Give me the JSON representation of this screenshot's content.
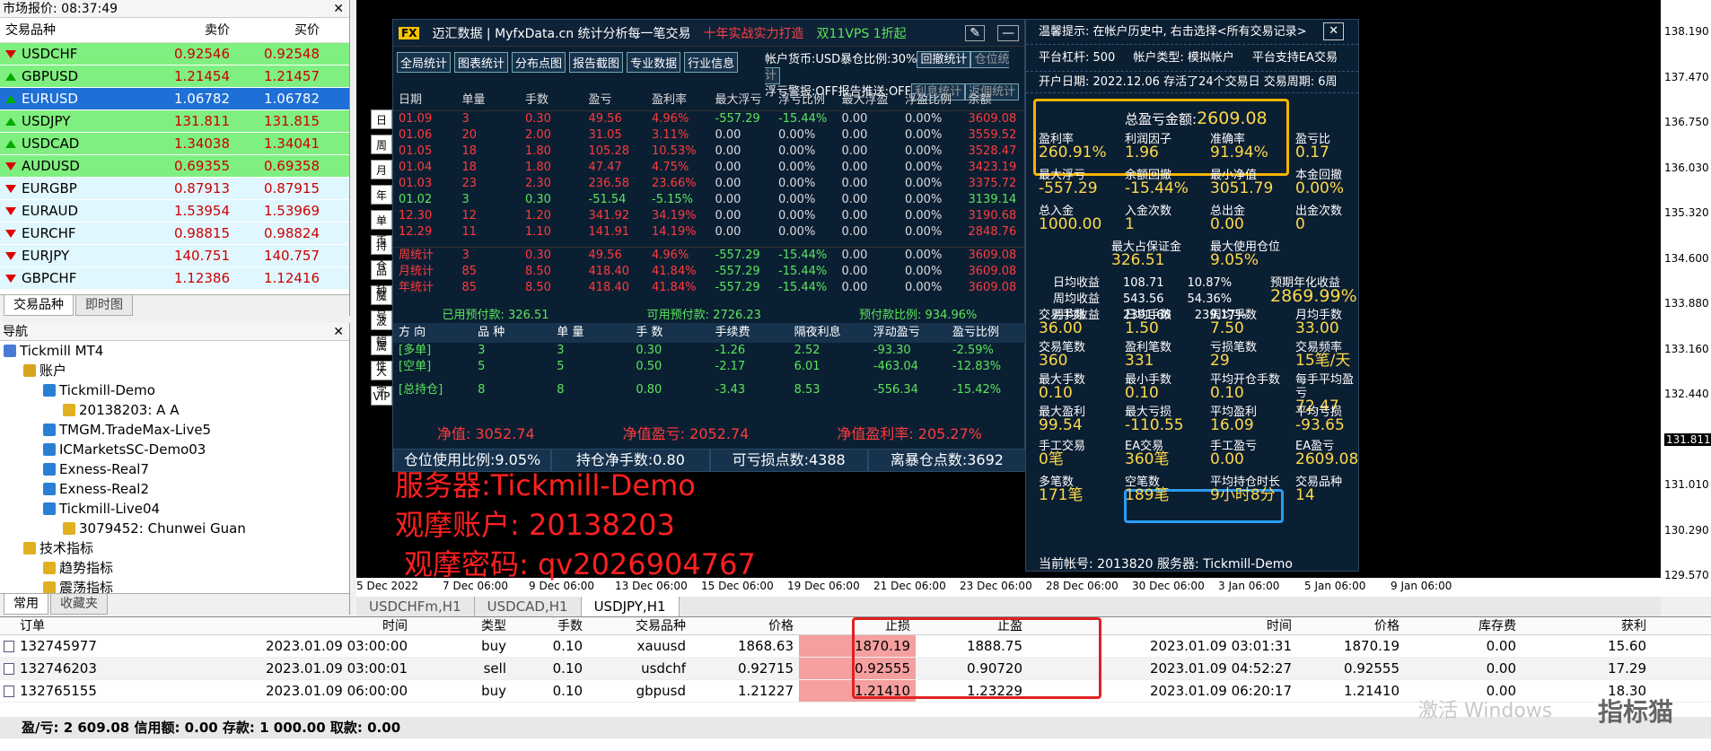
{
  "market_watch": {
    "title": "市场报价: 08:37:49",
    "col_symbol": "交易品种",
    "col_bid": "卖价",
    "col_ask": "买价",
    "rows": [
      {
        "sym": "USDCHF",
        "bid": "0.92546",
        "ask": "0.92548",
        "dir": "dn",
        "bg": "#7fef7f"
      },
      {
        "sym": "GBPUSD",
        "bid": "1.21454",
        "ask": "1.21457",
        "dir": "up",
        "bg": "#7fef7f"
      },
      {
        "sym": "EURUSD",
        "bid": "1.06782",
        "ask": "1.06782",
        "dir": "up",
        "bg": "#1e6fd6"
      },
      {
        "sym": "USDJPY",
        "bid": "131.811",
        "ask": "131.815",
        "dir": "up",
        "bg": "#7fef7f"
      },
      {
        "sym": "USDCAD",
        "bid": "1.34038",
        "ask": "1.34041",
        "dir": "up",
        "bg": "#7fef7f"
      },
      {
        "sym": "AUDUSD",
        "bid": "0.69355",
        "ask": "0.69358",
        "dir": "dn",
        "bg": "#7fef7f"
      },
      {
        "sym": "EURGBP",
        "bid": "0.87913",
        "ask": "0.87915",
        "dir": "dn",
        "bg": "#e0f7ff"
      },
      {
        "sym": "EURAUD",
        "bid": "1.53954",
        "ask": "1.53969",
        "dir": "dn",
        "bg": "#e0f7ff"
      },
      {
        "sym": "EURCHF",
        "bid": "0.98815",
        "ask": "0.98824",
        "dir": "dn",
        "bg": "#e0f7ff"
      },
      {
        "sym": "EURJPY",
        "bid": "140.751",
        "ask": "140.757",
        "dir": "dn",
        "bg": "#e0f7ff"
      },
      {
        "sym": "GBPCHF",
        "bid": "1.12386",
        "ask": "1.12416",
        "dir": "dn",
        "bg": "#e0f7ff"
      }
    ],
    "tab1": "交易品种",
    "tab2": "即时图"
  },
  "navigator": {
    "title": "导航",
    "items": [
      {
        "t": "Tickmill MT4",
        "lvl": 0,
        "c": "#4a7bd4"
      },
      {
        "t": "账户",
        "lvl": 1,
        "c": "#d8a420"
      },
      {
        "t": "Tickmill-Demo",
        "lvl": 2,
        "c": "#2a7fd4"
      },
      {
        "t": "20138203: A A",
        "lvl": 3,
        "c": "#e0b020"
      },
      {
        "t": "TMGM.TradeMax-Live5",
        "lvl": 2,
        "c": "#2a7fd4"
      },
      {
        "t": "ICMarketsSC-Demo03",
        "lvl": 2,
        "c": "#2a7fd4"
      },
      {
        "t": "Exness-Real7",
        "lvl": 2,
        "c": "#2a7fd4"
      },
      {
        "t": "Exness-Real2",
        "lvl": 2,
        "c": "#2a7fd4"
      },
      {
        "t": "Tickmill-Live04",
        "lvl": 2,
        "c": "#2a7fd4"
      },
      {
        "t": "3079452: Chunwei Guan",
        "lvl": 3,
        "c": "#e0b020"
      },
      {
        "t": "技术指标",
        "lvl": 1,
        "c": "#e0b020"
      },
      {
        "t": "趋势指标",
        "lvl": 2,
        "c": "#e0b020"
      },
      {
        "t": "震荡指标",
        "lvl": 2,
        "c": "#e0b020"
      }
    ],
    "tab1": "常用",
    "tab2": "收藏夹"
  },
  "stat": {
    "title": "迈汇数据 | MyfxData.cn  统计分析每一笔交易",
    "slogan": "十年实战实力打造",
    "promo": "双11VPS 1折起",
    "btns": [
      "全局统计",
      "图表统计",
      "分布点图",
      "报告截图",
      "专业数据",
      "行业信息"
    ],
    "info1": "帐户货币:USD暴仓比例:30%",
    "info1b": "回撤统计",
    "info1c": "仓位统计",
    "info2": "浮亏警报:OFF报告推送:OFF",
    "info2b": "利息统计",
    "info2c": "返佣统计",
    "side_btns": [
      "日",
      "周",
      "月",
      "年",
      "单币",
      "持仓",
      "品种",
      "魔号",
      "波幅",
      "属性",
      "大字",
      "VIP"
    ],
    "head": [
      "日期",
      "单量",
      "手数",
      "盈亏",
      "盈利率",
      "最大浮亏",
      "浮亏比例",
      "最大浮盈",
      "浮盈比例",
      "余额"
    ],
    "rows": [
      [
        "01.09",
        "3",
        "0.30",
        "49.56",
        "4.96%",
        "-557.29",
        "-15.44%",
        "0.00",
        "0.00%",
        "3609.08",
        "r"
      ],
      [
        "01.06",
        "20",
        "2.00",
        "31.05",
        "3.11%",
        "0.00",
        "0.00%",
        "0.00",
        "0.00%",
        "3559.52",
        "r"
      ],
      [
        "01.05",
        "18",
        "1.80",
        "105.28",
        "10.53%",
        "0.00",
        "0.00%",
        "0.00",
        "0.00%",
        "3528.47",
        "r"
      ],
      [
        "01.04",
        "18",
        "1.80",
        "47.47",
        "4.75%",
        "0.00",
        "0.00%",
        "0.00",
        "0.00%",
        "3423.19",
        "r"
      ],
      [
        "01.03",
        "23",
        "2.30",
        "236.58",
        "23.66%",
        "0.00",
        "0.00%",
        "0.00",
        "0.00%",
        "3375.72",
        "r"
      ],
      [
        "01.02",
        "3",
        "0.30",
        "-51.54",
        "-5.15%",
        "0.00",
        "0.00%",
        "0.00",
        "0.00%",
        "3139.14",
        "g"
      ],
      [
        "12.30",
        "12",
        "1.20",
        "341.92",
        "34.19%",
        "0.00",
        "0.00%",
        "0.00",
        "0.00%",
        "3190.68",
        "r"
      ],
      [
        "12.29",
        "11",
        "1.10",
        "141.91",
        "14.19%",
        "0.00",
        "0.00%",
        "0.00",
        "0.00%",
        "2848.76",
        "r"
      ]
    ],
    "sum": [
      [
        "周统计",
        "3",
        "0.30",
        "49.56",
        "4.96%",
        "-557.29",
        "-15.44%",
        "0.00",
        "0.00%",
        "3609.08"
      ],
      [
        "月统计",
        "85",
        "8.50",
        "418.40",
        "41.84%",
        "-557.29",
        "-15.44%",
        "0.00",
        "0.00%",
        "3609.08"
      ],
      [
        "年统计",
        "85",
        "8.50",
        "418.40",
        "41.84%",
        "-557.29",
        "-15.44%",
        "0.00",
        "0.00%",
        "3609.08"
      ]
    ],
    "margin_used": "已用预付款: 326.51",
    "margin_free": "可用预付款: 2726.23",
    "margin_ratio": "预付款比例: 934.96%",
    "pos_head": [
      "方 向",
      "品 种",
      "单 量",
      "手 数",
      "手续费",
      "隔夜利息",
      "浮动盈亏",
      "盈亏比例"
    ],
    "pos": [
      [
        "[多单]",
        "3",
        "3",
        "0.30",
        "-1.26",
        "2.52",
        "-93.30",
        "-2.59%"
      ],
      [
        "[空单]",
        "5",
        "5",
        "0.50",
        "-2.17",
        "6.01",
        "-463.04",
        "-12.83%"
      ],
      [
        "[总持仓]",
        "8",
        "8",
        "0.80",
        "-3.43",
        "8.53",
        "-556.34",
        "-15.42%"
      ]
    ],
    "net": "净值: 3052.74",
    "net_pl": "净值盈亏: 2052.74",
    "net_rate": "净值盈利率: 205.27%",
    "foot": [
      "仓位使用比例:9.05%",
      "持仓净手数:0.80",
      "可亏损点数:4388",
      "离暴仓点数:3692"
    ]
  },
  "overlay": {
    "l1": "服务器:Tickmill-Demo",
    "l2": "观摩账户: 20138203",
    "l3": "观摩密码: qv2026904767"
  },
  "side": {
    "tip": "温馨提示: 在帐户历史中, 右击选择<所有交易记录>",
    "lev": "平台杠杆: 500",
    "acct_type": "帐户类型: 模拟帐户",
    "ea": "平台支持EA交易",
    "open": "开户日期: 2022.12.06 存活了24个交易日 交易周期: 6周",
    "total_label": "总盈亏金额:",
    "total": "2609.08",
    "g1": [
      [
        "盈利率",
        "260.91%"
      ],
      [
        "利润因子",
        "1.96"
      ],
      [
        "准确率",
        "91.94%"
      ],
      [
        "盈亏比",
        "0.17"
      ]
    ],
    "g2": [
      [
        "最大浮亏",
        "-557.29"
      ],
      [
        "余额回撤",
        "-15.44%"
      ],
      [
        "最小净值",
        "3051.79"
      ],
      [
        "本金回撤",
        "0.00%"
      ]
    ],
    "g3": [
      [
        "总入金",
        "1000.00"
      ],
      [
        "入金次数",
        "1"
      ],
      [
        "总出金",
        "0.00"
      ],
      [
        "出金次数",
        "0"
      ]
    ],
    "g4": [
      [
        "最大占保证金",
        "326.51"
      ],
      [
        "最大使用仓位",
        "9.05%"
      ]
    ],
    "daily": [
      [
        "日均收益",
        "108.71",
        "10.87%"
      ],
      [
        "周均收益",
        "543.56",
        "54.36%"
      ],
      [
        "月均收益",
        "2391.66",
        "239.17%"
      ]
    ],
    "annual_label": "预期年化收益",
    "annual": "2869.99%",
    "g5": [
      [
        "交易手数",
        "36.00"
      ],
      [
        "日均手数",
        "1.50"
      ],
      [
        "周均手数",
        "7.50"
      ],
      [
        "月均手数",
        "33.00"
      ]
    ],
    "g6": [
      [
        "交易笔数",
        "360"
      ],
      [
        "盈利笔数",
        "331"
      ],
      [
        "亏损笔数",
        "29"
      ],
      [
        "交易频率",
        "15笔/天"
      ]
    ],
    "g7": [
      [
        "最大手数",
        "0.10"
      ],
      [
        "最小手数",
        "0.10"
      ],
      [
        "平均开仓手数",
        "0.10"
      ],
      [
        "每手平均盈亏",
        "72.47"
      ]
    ],
    "g8": [
      [
        "最大盈利",
        "99.54"
      ],
      [
        "最大亏损",
        "-110.55"
      ],
      [
        "平均盈利",
        "16.09"
      ],
      [
        "平均亏损",
        "-93.65"
      ]
    ],
    "g9": [
      [
        "手工交易",
        "0笔"
      ],
      [
        "EA交易",
        "360笔"
      ],
      [
        "手工盈亏",
        "0.00"
      ],
      [
        "EA盈亏",
        "2609.08"
      ]
    ],
    "g10": [
      [
        "多笔数",
        "171笔"
      ],
      [
        "空笔数",
        "189笔"
      ],
      [
        "平均持仓时长",
        "9小时8分"
      ],
      [
        "交易品种",
        "14"
      ]
    ],
    "cur": "当前帐号: 2013820 服务器: Tickmill-Demo"
  },
  "prices": [
    "138.190",
    "137.470",
    "136.750",
    "136.030",
    "135.320",
    "134.600",
    "133.880",
    "133.160",
    "132.440",
    "131.811",
    "131.010",
    "130.290",
    "129.570"
  ],
  "times": [
    "5 Dec 2022",
    "7 Dec 06:00",
    "9 Dec 06:00",
    "13 Dec 06:00",
    "15 Dec 06:00",
    "19 Dec 06:00",
    "21 Dec 06:00",
    "23 Dec 06:00",
    "28 Dec 06:00",
    "30 Dec 06:00",
    "3 Jan 06:00",
    "5 Jan 06:00",
    "9 Jan 06:00"
  ],
  "sym_tabs": [
    "USDCHFm,H1",
    "USDCAD,H1",
    "USDJPY,H1"
  ],
  "orders": {
    "head": [
      "订单",
      "时间",
      "类型",
      "手数",
      "交易品种",
      "价格",
      "止损",
      "止盈",
      "时间",
      "价格",
      "库存费",
      "获利"
    ],
    "rows": [
      [
        "132745977",
        "2023.01.09 03:00:00",
        "buy",
        "0.10",
        "xauusd",
        "1868.63",
        "1870.19",
        "1888.75",
        "2023.01.09 03:01:31",
        "1870.19",
        "0.00",
        "15.60"
      ],
      [
        "132746203",
        "2023.01.09 03:00:01",
        "sell",
        "0.10",
        "usdchf",
        "0.92715",
        "0.92555",
        "0.90720",
        "2023.01.09 04:52:27",
        "0.92555",
        "0.00",
        "17.29"
      ],
      [
        "132765155",
        "2023.01.09 06:00:00",
        "buy",
        "0.10",
        "gbpusd",
        "1.21227",
        "1.21410",
        "1.23229",
        "2023.01.09 06:20:17",
        "1.21410",
        "0.00",
        "18.30"
      ]
    ],
    "summary": "盈/亏: 2 609.08 信用额: 0.00 存款: 1 000.00 取款: 0.00"
  },
  "watermark": "激活 Windows",
  "logo": "指标猫"
}
